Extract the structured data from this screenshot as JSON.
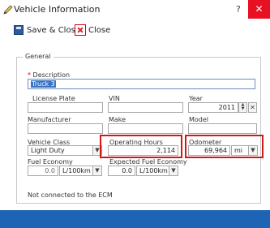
{
  "window": {
    "title": "Vehicle Information",
    "help": "?",
    "close": "✕"
  },
  "toolbar": {
    "save_close": "Save & Close",
    "close": "Close"
  },
  "group": {
    "legend": "General"
  },
  "description": {
    "required_mark": "*",
    "label": "Description",
    "value": "Truck 3"
  },
  "license_plate": {
    "label": "License Plate",
    "value": ""
  },
  "vin": {
    "label": "VIN",
    "value": ""
  },
  "year": {
    "label": "Year",
    "value": "2011"
  },
  "manufacturer": {
    "label": "Manufacturer",
    "value": ""
  },
  "make": {
    "label": "Make",
    "value": ""
  },
  "model": {
    "label": "Model",
    "value": ""
  },
  "vehicle_class": {
    "label": "Vehicle Class",
    "value": "Light Duty"
  },
  "operating_hours": {
    "label": "Operating Hours",
    "value": "2,114"
  },
  "odometer": {
    "label": "Odometer",
    "value": "69,964",
    "unit": "mi"
  },
  "fuel_economy": {
    "label": "Fuel Economy",
    "value": "0.0",
    "unit": "L/100km"
  },
  "expected_fuel_economy": {
    "label": "Expected Fuel Economy",
    "value": "0.0",
    "unit": "L/100km"
  },
  "status": {
    "text": "Not connected to the ECM"
  },
  "colors": {
    "accent": "#1e64b4",
    "close": "#e81123",
    "highlight": "#d01818"
  },
  "icons": {
    "title": "truck-pen-icon",
    "save": "floppy-disk-icon",
    "close": "red-x-icon"
  }
}
